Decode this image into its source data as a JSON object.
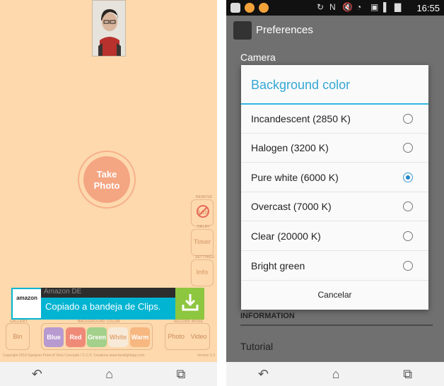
{
  "left": {
    "take_photo": "Take Photo",
    "side_buttons": [
      {
        "caption": "REMOVE",
        "label": "Ads"
      },
      {
        "caption": "DELAY",
        "label": "Timer"
      },
      {
        "caption": "SETTINGS",
        "label": "Info"
      }
    ],
    "ad": {
      "brand": "amazon",
      "title": "Amazon DE",
      "toast": "Copiado a bandeja de Clips."
    },
    "gallery_caption": "GALLERY",
    "bin_label": "Bin",
    "bg_caption": "BACKGROUND COLOR",
    "colors": [
      {
        "label": "Blue",
        "color": "#b79ad0"
      },
      {
        "label": "Red",
        "color": "#f08a78"
      },
      {
        "label": "Green",
        "color": "#a3d08a"
      },
      {
        "label": "White",
        "color": "#f7ead8"
      },
      {
        "label": "Warm",
        "color": "#f7b780"
      }
    ],
    "record_caption": "RECORD MODE",
    "photo_label": "Photo",
    "video_label": "Video",
    "copyright": "Copyright 2014 Spelgner Point of View Concepts / C.C.P. Creations   www.facelightapp.com",
    "version": "Version 2.3"
  },
  "right": {
    "clock": "16:55",
    "title": "Preferences",
    "camera_header": "Camera",
    "dialog_title": "Background color",
    "options": [
      {
        "label": "Incandescent (2850 K)",
        "selected": false
      },
      {
        "label": "Halogen (3200 K)",
        "selected": false
      },
      {
        "label": "Pure white (6000 K)",
        "selected": true
      },
      {
        "label": "Overcast (7000 K)",
        "selected": false
      },
      {
        "label": "Clear (20000 K)",
        "selected": false
      },
      {
        "label": "Bright green",
        "selected": false
      }
    ],
    "cancel": "Cancelar",
    "info_header": "INFORMATION",
    "tutorial": "Tutorial"
  }
}
